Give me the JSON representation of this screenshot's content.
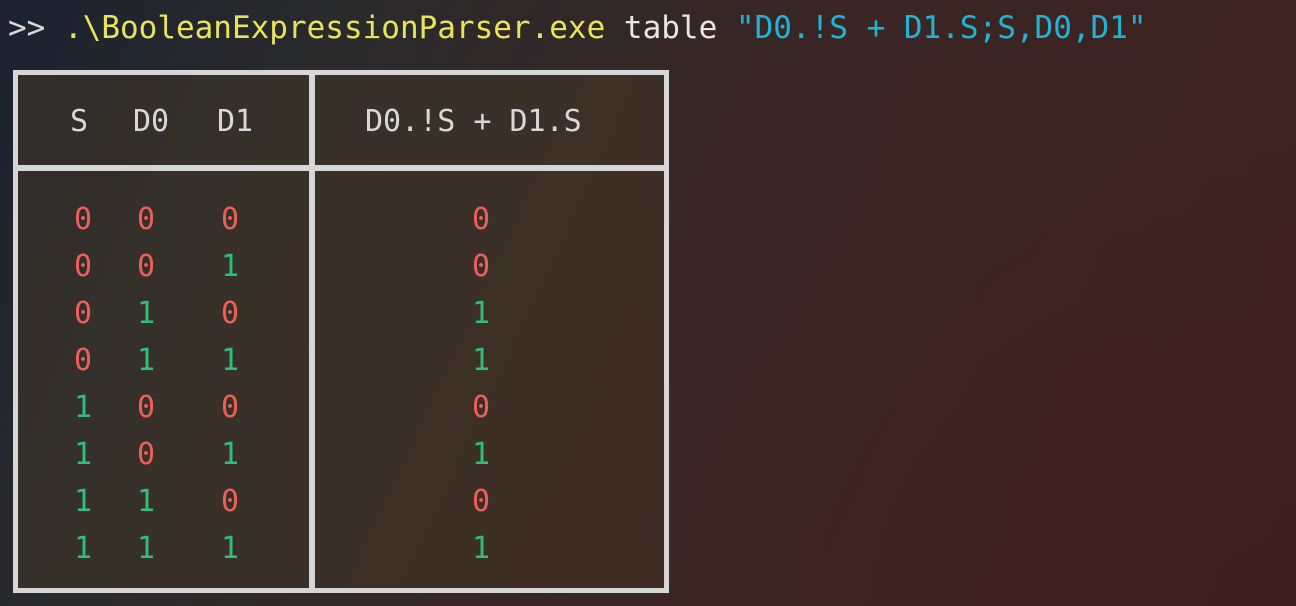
{
  "terminal": {
    "prompt": ">>",
    "executable": ".\\BooleanExpressionParser.exe",
    "subcommand": "table",
    "argument": "\"D0.!S + D1.S;S,D0,D1\""
  },
  "truth_table": {
    "input_headers": [
      "S",
      "D0",
      "D1"
    ],
    "output_header": "D0.!S + D1.S",
    "rows": [
      {
        "inputs": [
          "0",
          "0",
          "0"
        ],
        "output": "0"
      },
      {
        "inputs": [
          "0",
          "0",
          "1"
        ],
        "output": "0"
      },
      {
        "inputs": [
          "0",
          "1",
          "0"
        ],
        "output": "1"
      },
      {
        "inputs": [
          "0",
          "1",
          "1"
        ],
        "output": "1"
      },
      {
        "inputs": [
          "1",
          "0",
          "0"
        ],
        "output": "0"
      },
      {
        "inputs": [
          "1",
          "0",
          "1"
        ],
        "output": "1"
      },
      {
        "inputs": [
          "1",
          "1",
          "0"
        ],
        "output": "0"
      },
      {
        "inputs": [
          "1",
          "1",
          "1"
        ],
        "output": "1"
      }
    ]
  },
  "colors": {
    "false_value": "#ec5f5b",
    "true_value": "#2fbf78",
    "executable": "#e8e35a",
    "string_argument": "#20b3d6",
    "table_border": "#d6d6d6"
  }
}
